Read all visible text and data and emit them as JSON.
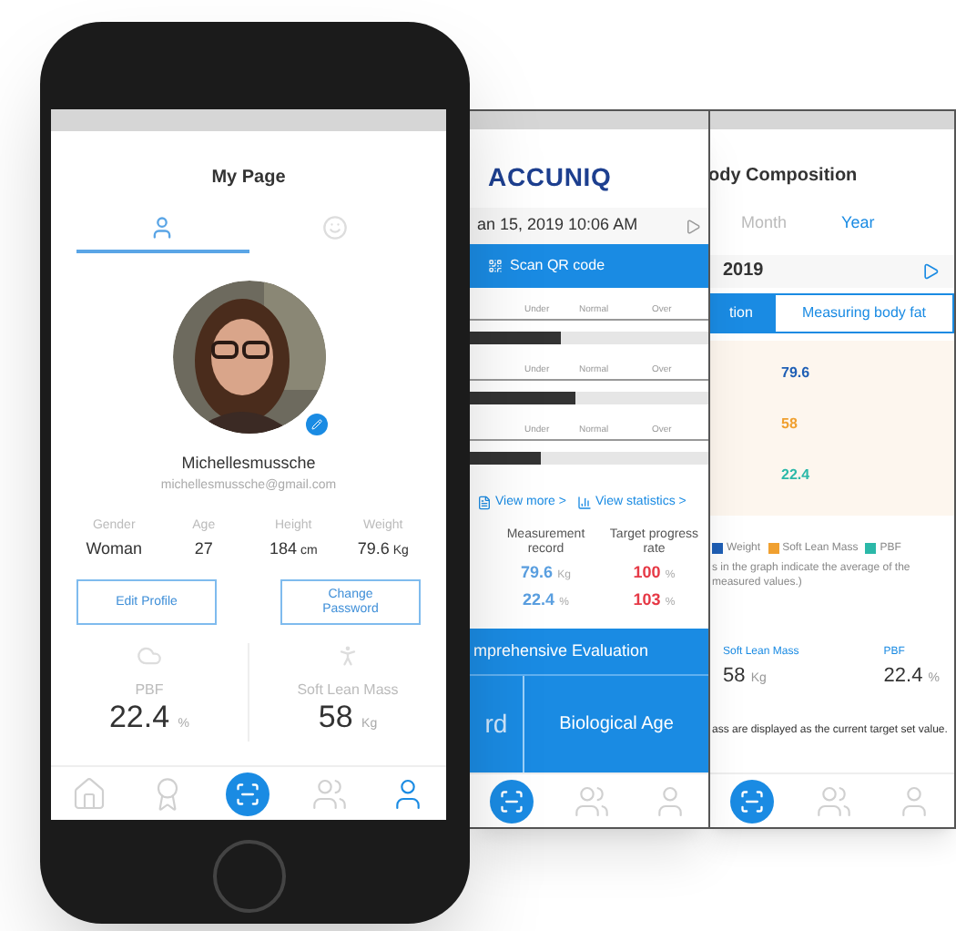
{
  "my_page": {
    "title": "My Page",
    "tabs": [
      {
        "kind": "user",
        "selected": true
      },
      {
        "kind": "face",
        "selected": false
      }
    ],
    "profile": {
      "name": "Michellesmussche",
      "email": "michellesmussche@gmail.com"
    },
    "stats": [
      {
        "label": "Gender",
        "value": "Woman"
      },
      {
        "label": "Age",
        "value": "27"
      },
      {
        "label": "Height",
        "value": "184",
        "unit": "cm"
      },
      {
        "label": "Weight",
        "value": "79.6",
        "unit": "Kg"
      }
    ],
    "buttons": [
      "Edit Profile",
      "Change Password"
    ],
    "metrics": [
      {
        "kind": "cloud",
        "label": "PBF",
        "value": "22.4",
        "unit": "%"
      },
      {
        "kind": "figure",
        "label": "Soft Lean Mass",
        "value": "58",
        "unit": "Kg"
      }
    ],
    "nav": [
      {
        "kind": "home",
        "selected": false
      },
      {
        "kind": "badge",
        "selected": false
      },
      {
        "kind": "scan",
        "selected": false
      },
      {
        "kind": "people",
        "selected": false
      },
      {
        "kind": "user",
        "selected": true
      }
    ]
  },
  "result_screen": {
    "logo": "ACCUNIQ",
    "date": "an 15, 2019 10:06 AM",
    "banner": "Scan QR code",
    "bars": [
      {
        "scale": [
          "Under",
          "Normal",
          "Over"
        ],
        "level": 0.38
      },
      {
        "scale": [
          "Under",
          "Normal",
          "Over"
        ],
        "level": 0.44
      },
      {
        "scale": [
          "Under",
          "Normal",
          "Over"
        ],
        "level": 0.3
      }
    ],
    "links": [
      {
        "kind": "more",
        "label": "View more >"
      },
      {
        "kind": "stats",
        "label": "View statistics >"
      }
    ],
    "table": {
      "columns": [
        "Measurement record",
        "Target progress rate"
      ],
      "rows": [
        [
          {
            "value": "79.6",
            "unit": "Kg"
          },
          {
            "value": "100",
            "unit": "%"
          }
        ],
        [
          {
            "value": "22.4",
            "unit": "%"
          },
          {
            "value": "103",
            "unit": "%"
          }
        ]
      ]
    },
    "evaluation": {
      "title": "mprehensive Evaluation",
      "tabs": [
        "rd",
        "Biological Age"
      ]
    },
    "nav": [
      {
        "kind": "scan",
        "selected": false
      },
      {
        "kind": "people",
        "selected": false
      },
      {
        "kind": "user",
        "selected": false
      }
    ]
  },
  "composition_screen": {
    "title": "ody Composition",
    "tabs": [
      {
        "label": "Month",
        "selected": false
      },
      {
        "label": "Year",
        "selected": true
      }
    ],
    "year": "2019",
    "segments": [
      {
        "label": "tion",
        "selected": true
      },
      {
        "label": "Measuring body fat",
        "selected": false
      }
    ],
    "chart_labels": [
      {
        "text": "79.6",
        "color": "#1f5fb5"
      },
      {
        "text": "58",
        "color": "#f0a030"
      },
      {
        "text": "22.4",
        "color": "#2bb8a8"
      }
    ],
    "legend": [
      {
        "label": "Weight",
        "color": "#1f5fb5"
      },
      {
        "label": "Soft Lean Mass",
        "color": "#f0a030"
      },
      {
        "label": "PBF",
        "color": "#2bb8a8"
      }
    ],
    "note": "s in the graph indicate the average of the measured values.)",
    "metrics": [
      {
        "label": "Soft Lean Mass",
        "value": "58",
        "unit": "Kg"
      },
      {
        "label": "PBF",
        "value": "22.4",
        "unit": "%"
      }
    ],
    "footnote": "ass are displayed as the current target set value.",
    "nav": [
      {
        "kind": "scan",
        "selected": false
      },
      {
        "kind": "people",
        "selected": false
      },
      {
        "kind": "user",
        "selected": false
      }
    ]
  }
}
